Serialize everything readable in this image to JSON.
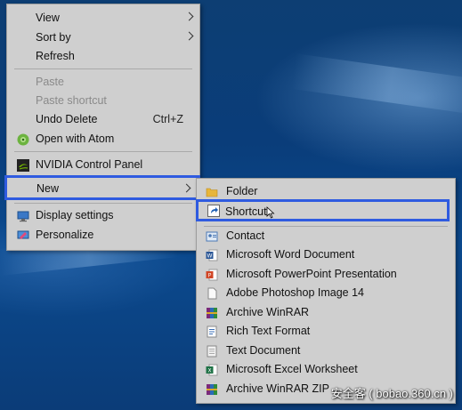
{
  "context_menu": {
    "items": [
      {
        "label": "View"
      },
      {
        "label": "Sort by"
      },
      {
        "label": "Refresh"
      },
      {
        "label": "Paste"
      },
      {
        "label": "Paste shortcut"
      },
      {
        "label": "Undo Delete",
        "shortcut": "Ctrl+Z"
      },
      {
        "label": "Open with Atom"
      },
      {
        "label": "NVIDIA Control Panel"
      },
      {
        "label": "New"
      },
      {
        "label": "Display settings"
      },
      {
        "label": "Personalize"
      }
    ]
  },
  "new_submenu": {
    "items": [
      {
        "label": "Folder"
      },
      {
        "label": "Shortcut"
      },
      {
        "label": "Contact"
      },
      {
        "label": "Microsoft Word Document"
      },
      {
        "label": "Microsoft PowerPoint Presentation"
      },
      {
        "label": "Adobe Photoshop Image 14"
      },
      {
        "label": "Archive WinRAR"
      },
      {
        "label": "Rich Text Format"
      },
      {
        "label": "Text Document"
      },
      {
        "label": "Microsoft Excel Worksheet"
      },
      {
        "label": "Archive WinRAR ZIP"
      }
    ]
  },
  "highlight_color": "#2f5be0",
  "watermark": "安全客 ( bobao.360.cn )"
}
